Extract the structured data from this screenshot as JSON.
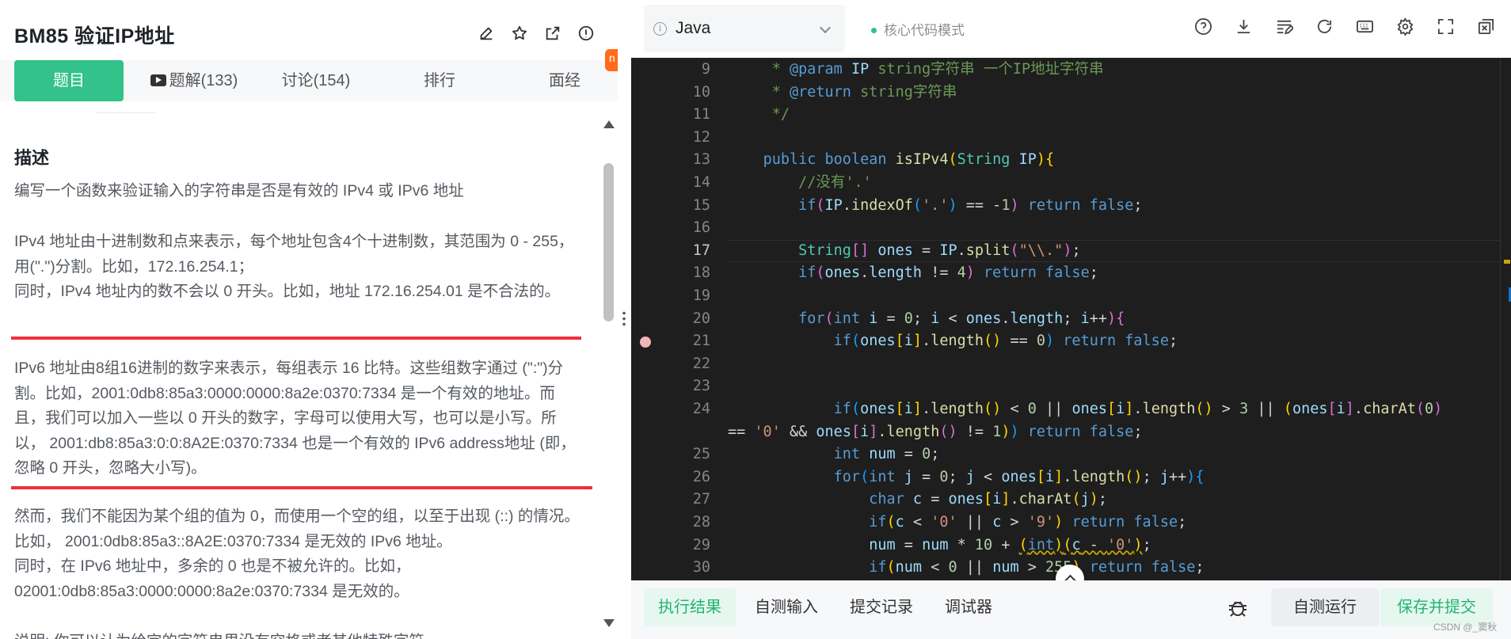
{
  "problem": {
    "title": "BM85  验证IP地址",
    "actions": [
      "edit-icon",
      "star-icon",
      "external-link-icon",
      "info-icon"
    ]
  },
  "tabs": [
    {
      "label": "题目"
    },
    {
      "label": "题解(133)"
    },
    {
      "label": "讨论(154)"
    },
    {
      "label": "排行"
    },
    {
      "label": "面经"
    }
  ],
  "side_badge": "n",
  "description": {
    "heading": "描述",
    "p1": "编写一个函数来验证输入的字符串是否是有效的 IPv4 或 IPv6 地址",
    "p2": "IPv4 地址由十进制数和点来表示，每个地址包含4个十进制数，其范围为 0 - 255， 用(\".\")分割。比如，172.16.254.1；",
    "p3": "同时，IPv4 地址内的数不会以 0 开头。比如，地址 172.16.254.01 是不合法的。",
    "p4": "IPv6 地址由8组16进制的数字来表示，每组表示 16 比特。这些组数字通过 (\":\")分割。比如，2001:0db8:85a3:0000:0000:8a2e:0370:7334 是一个有效的地址。而且，我们可以加入一些以 0 开头的数字，字母可以使用大写，也可以是小写。所以， 2001:db8:85a3:0:0:8A2E:0370:7334 也是一个有效的 IPv6 address地址 (即，忽略 0 开头，忽略大小写)。",
    "p5": "然而，我们不能因为某个组的值为 0，而使用一个空的组，以至于出现 (::) 的情况。 比如， 2001:0db8:85a3::8A2E:0370:7334 是无效的 IPv6 地址。",
    "p6": "同时，在 IPv6 地址中，多余的 0 也是不被允许的。比如， 02001:0db8:85a3:0000:0000:8a2e:0370:7334 是无效的。",
    "p7": "说明: 你可以认为给定的字符串里没有空格或者其他特殊字符。"
  },
  "editor": {
    "language": "Java",
    "mode": "核心代码模式",
    "toolbar_icons": [
      "help-icon",
      "download-icon",
      "format-icon",
      "reset-icon",
      "keyboard-icon",
      "settings-icon",
      "fullscreen-icon",
      "window-icon"
    ],
    "current_line": 17,
    "breakpoint_line": 21,
    "line_numbers": [
      "9",
      "10",
      "11",
      "12",
      "13",
      "14",
      "15",
      "16",
      "17",
      "18",
      "19",
      "20",
      "21",
      "22",
      "23",
      "24",
      "",
      "25",
      "26",
      "27",
      "28",
      "29",
      "30"
    ]
  },
  "bottom": {
    "tabs": [
      "执行结果",
      "自测输入",
      "提交记录",
      "调试器"
    ],
    "run_label": "自测运行",
    "submit_label": "保存并提交"
  },
  "watermark": "CSDN @_窦秋"
}
